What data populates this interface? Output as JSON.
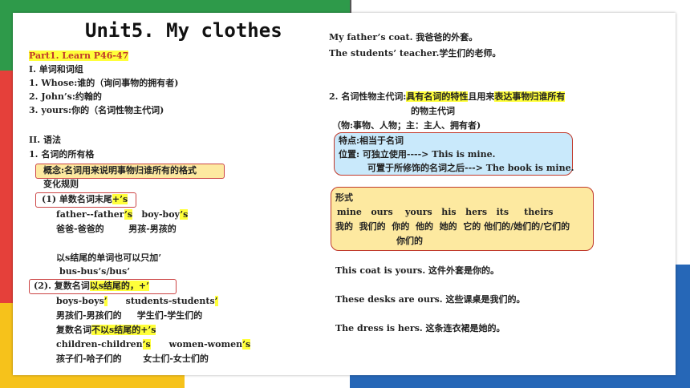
{
  "colors": {
    "green": "#2e9a4a",
    "red": "#e5403a",
    "yellow": "#f6c21b",
    "blue": "#2667b7",
    "highlight": "#ffff3a",
    "lightblue": "#c9e9fb",
    "lightyellow": "#fde9a0"
  },
  "title": "Unit5. My clothes",
  "left": {
    "part": "Part1. Learn P46-47",
    "s1": "I. 单词和词组",
    "w1": "1. Whose:谁的（询问事物的拥有者)",
    "w2": "2. John’s:约翰的",
    "w3": "3. yours:你的（名词性物主代词)",
    "s2": "II. 语法",
    "g1": "1. 名词的所有格",
    "concept": "概念:名词用来说明事物归谁所有的格式",
    "rule": "变化规则",
    "r1a": "(1) 单数名词末尾",
    "r1b": "+’s",
    "ex1a": "father--father",
    "ex1b": "’s",
    "ex1c": "boy-boy",
    "ex1d": "’s",
    "ex1zh": "爸爸-爸爸的        男孩-男孩的",
    "note": "以s结尾的单词也可以只加’",
    "note2": "bus-bus’s/bus’",
    "r2a": "(2). 复数名词",
    "r2b": "以s结尾的，+’",
    "ex2a": "boys-boys",
    "ex2b": "’",
    "ex2c": "students-students",
    "ex2d": "’",
    "ex2zh": "男孩们-男孩们的     学生们-学生们的",
    "r3a": "复数名词",
    "r3b": "不以s结尾的+’s",
    "ex3a": "children-children",
    "ex3b": "’s",
    "ex3c": "women-women",
    "ex3d": "’s",
    "ex3zh": "孩子们-哈子们的       女士们-女士们的"
  },
  "right": {
    "e1": "My father’s coat. 我爸爸的外套。",
    "e2": "The students’ teacher.学生们的老师。",
    "g2a": "2. 名词性物主代词:",
    "g2b": "具有名词的特性",
    "g2c": "且用来",
    "g2d": "表达事物归谁所有",
    "g2e": "的物主代词",
    "g2f": "（物:事物、人物；主：主人、拥有者)",
    "f1": "特点:相当于名词",
    "f2": "位置: 可独立使用----> This is mine.",
    "f3": "可置于所修饰的名词之后---> The book is mine.",
    "x0": "形式",
    "x1": [
      "mine",
      "ours",
      "yours",
      "his",
      "hers",
      "its",
      "theirs"
    ],
    "x2": "我的  我们的  你的  他的  她的  它的 他们的/她们的/它们的",
    "x3": "你们的",
    "s1": "This coat is yours. 这件外套是你的。",
    "s2": "These desks are ours. 这些课桌是我们的。",
    "s3": "The dress is hers. 这条连衣裙是她的。"
  }
}
